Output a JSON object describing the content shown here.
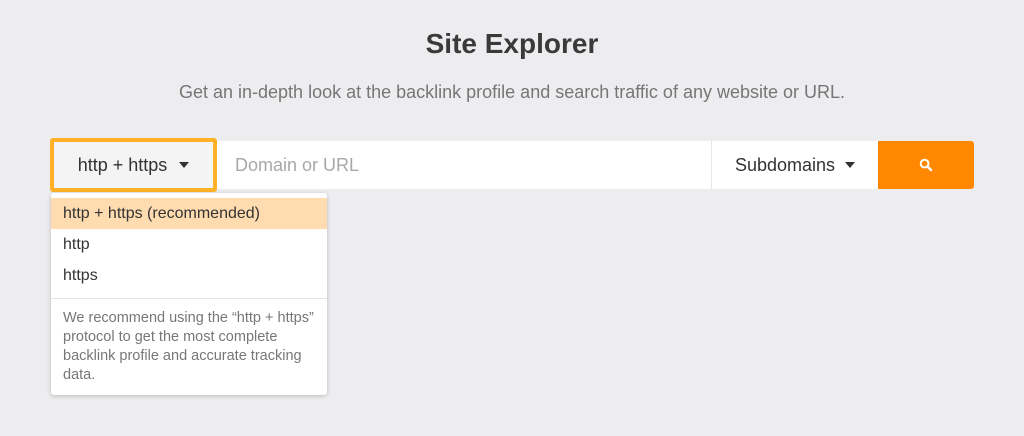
{
  "page": {
    "title": "Site Explorer",
    "subtitle": "Get an in-depth look at the backlink profile and search traffic of any website or URL."
  },
  "search": {
    "protocol": {
      "selected": "http + https",
      "caret_icon": "caret-down-icon",
      "highlight_color": "#ffb226"
    },
    "input": {
      "value": "",
      "placeholder": "Domain or URL"
    },
    "mode": {
      "selected": "Subdomains",
      "caret_icon": "caret-down-icon"
    },
    "button": {
      "icon": "search-icon",
      "color": "#ff8800"
    }
  },
  "dropdown": {
    "options": [
      {
        "label": "http + https (recommended)",
        "active": true
      },
      {
        "label": "http",
        "active": false
      },
      {
        "label": "https",
        "active": false
      }
    ],
    "note": "We recommend using the “http + https” protocol to get the most complete backlink profile and accurate tracking data.",
    "active_color": "#ffdcb0"
  }
}
